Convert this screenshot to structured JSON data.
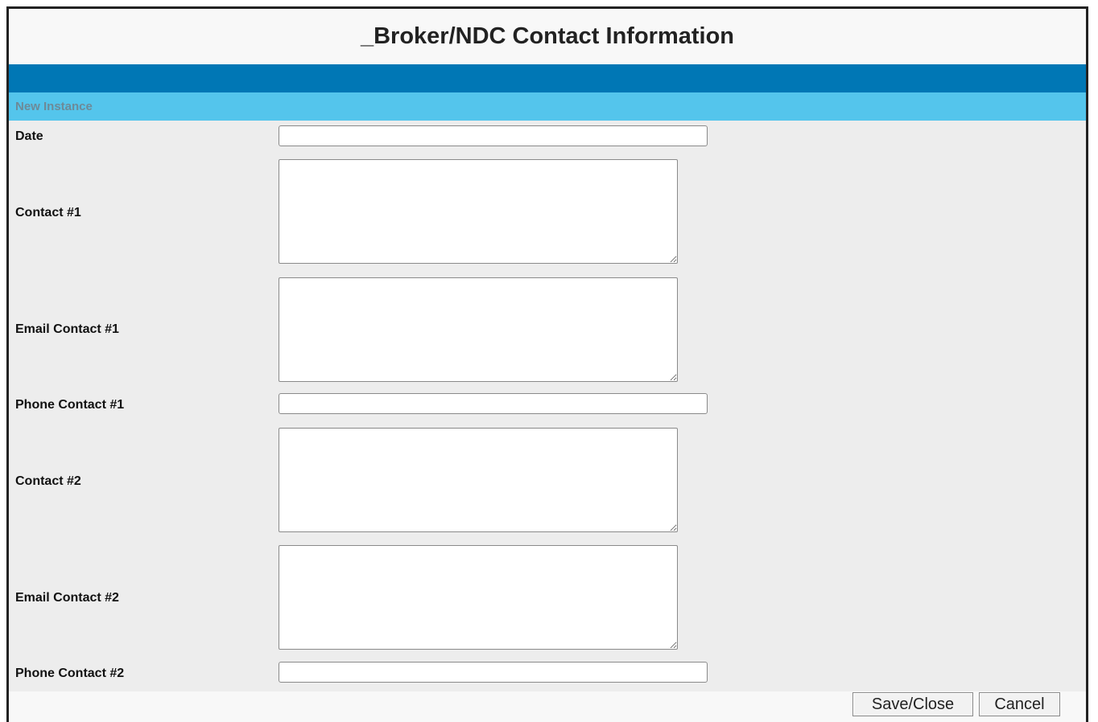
{
  "title": "_Broker/NDC Contact Information",
  "section": {
    "label": "New Instance"
  },
  "fields": [
    {
      "label": "Date",
      "value": ""
    },
    {
      "label": "Contact #1",
      "value": ""
    },
    {
      "label": "Email Contact #1",
      "value": ""
    },
    {
      "label": "Phone Contact #1",
      "value": ""
    },
    {
      "label": "Contact #2",
      "value": ""
    },
    {
      "label": "Email Contact #2",
      "value": ""
    },
    {
      "label": "Phone Contact #2",
      "value": ""
    }
  ],
  "buttons": {
    "save_label": "Save/Close",
    "cancel_label": "Cancel"
  },
  "colors": {
    "header_band": "#0077b5",
    "section_band": "#54c5ec",
    "form_bg": "#ededed"
  }
}
